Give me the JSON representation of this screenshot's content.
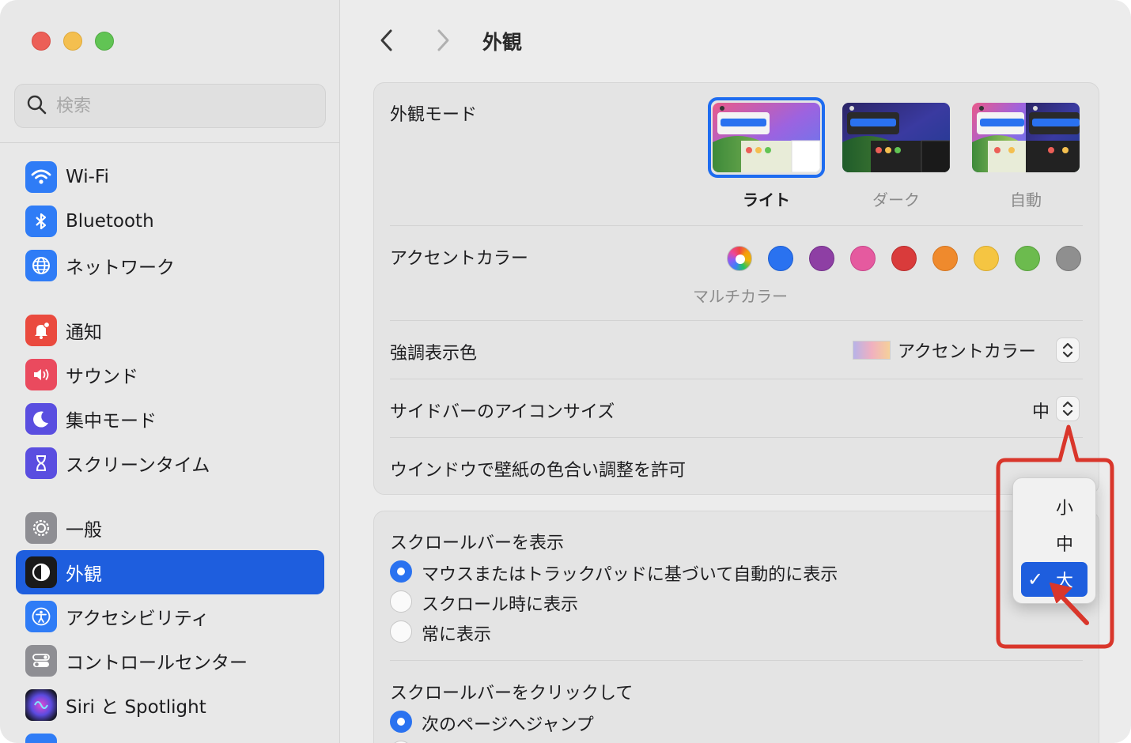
{
  "window": {
    "title": "外観"
  },
  "search": {
    "placeholder": "検索"
  },
  "sidebar": {
    "items": [
      {
        "label": "Wi-Fi"
      },
      {
        "label": "Bluetooth"
      },
      {
        "label": "ネットワーク"
      },
      {
        "label": "通知"
      },
      {
        "label": "サウンド"
      },
      {
        "label": "集中モード"
      },
      {
        "label": "スクリーンタイム"
      },
      {
        "label": "一般"
      },
      {
        "label": "外観",
        "selected": true
      },
      {
        "label": "アクセシビリティ"
      },
      {
        "label": "コントロールセンター"
      },
      {
        "label": "Siri と Spotlight"
      }
    ]
  },
  "appearance": {
    "mode_label": "外観モード",
    "modes": [
      {
        "label": "ライト",
        "selected": true
      },
      {
        "label": "ダーク"
      },
      {
        "label": "自動"
      }
    ],
    "accent_label": "アクセントカラー",
    "accent_colors": [
      "multicolor",
      "#2a72f0",
      "#8e3fa4",
      "#e55a9f",
      "#d93b3b",
      "#ef8a2d",
      "#f5c542",
      "#6cbb4e",
      "#8f8f8f"
    ],
    "accent_selected_name": "マルチカラー",
    "highlight_label": "強調表示色",
    "highlight_value": "アクセントカラー",
    "sidebar_icon_label": "サイドバーのアイコンサイズ",
    "sidebar_icon_value": "中",
    "wallpaper_tint_label": "ウインドウで壁紙の色合い調整を許可"
  },
  "popup_menu": {
    "items": [
      {
        "label": "小"
      },
      {
        "label": "中"
      },
      {
        "label": "大",
        "selected": true
      }
    ],
    "check": "✓"
  },
  "scrollbars": {
    "show_label": "スクロールバーを表示",
    "show_options": [
      {
        "label": "マウスまたはトラックパッドに基づいて自動的に表示",
        "selected": true
      },
      {
        "label": "スクロール時に表示"
      },
      {
        "label": "常に表示"
      }
    ],
    "click_label": "スクロールバーをクリックして",
    "click_options": [
      {
        "label": "次のページへジャンプ",
        "selected": true
      }
    ]
  },
  "colors": {
    "accent_blue": "#1e5ede",
    "annotation_red": "#d9362b"
  }
}
